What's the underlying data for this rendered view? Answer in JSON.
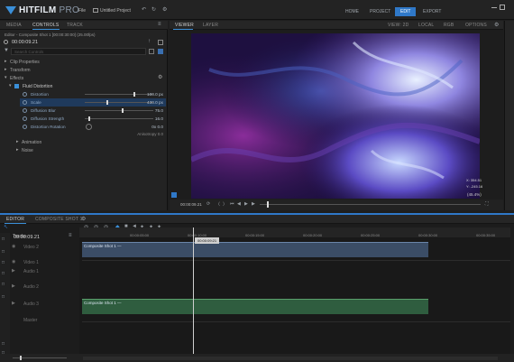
{
  "app": {
    "logo_name": "HITFILM",
    "logo_edition": "PRO",
    "menu_file": "File",
    "project_name": "Untitled Project",
    "undo_icon": "undo-icon",
    "redo_icon": "redo-icon",
    "settings_icon": "gear-icon"
  },
  "nav": {
    "tabs": [
      "HOME",
      "PROJECT",
      "EDIT",
      "EXPORT"
    ],
    "active": "EDIT"
  },
  "left_panel": {
    "tabs": [
      "MEDIA",
      "CONTROLS",
      "TRACK"
    ],
    "active_tab": "CONTROLS",
    "editor_title": "Editor - Composite Shot 1 [00:00:30:00] (25.00fps)",
    "timecode": "00:00:09.21",
    "search_placeholder": "Search Controls",
    "sections": [
      {
        "label": "Clip Properties"
      },
      {
        "label": "Transform"
      },
      {
        "label": "Effects"
      }
    ],
    "effect_name": "Fluid Distortion",
    "properties": [
      {
        "label": "Distortion",
        "value": "100.0 px",
        "fraction": 0.72
      },
      {
        "label": "Scale",
        "value": "430.0 px",
        "fraction": 0.32
      },
      {
        "label": "Diffusion Blur",
        "value": "75.0",
        "fraction": 0.55
      },
      {
        "label": "Diffusion Strength",
        "value": "16.0",
        "fraction": 0.06
      },
      {
        "label": "Distortion Rotation",
        "value": "0x     0.0",
        "fraction": null
      }
    ],
    "anisotropy_line": "Anisotropy  0.0",
    "after_sections": [
      {
        "label": "Animation"
      },
      {
        "label": "Noise"
      }
    ]
  },
  "viewer": {
    "tabs": [
      "VIEWER",
      "LAYER"
    ],
    "active_tab": "VIEWER",
    "view_label": "VIEW: 2D",
    "local_label": "LOCAL",
    "rgb_label": "RGB",
    "options_label": "OPTIONS",
    "timecode": "00:00:09.21",
    "readout_1": "X: 354.51",
    "readout_2": "Y: -245.16",
    "zoom_label": "(45.4%)"
  },
  "timeline": {
    "tabs": [
      "EDITOR",
      "COMPOSITE SHOT 1"
    ],
    "active_tab": "EDITOR",
    "timecode": "00:00:09.21",
    "playhead_tooltip": "00:00:09:21",
    "tracks_label": "Tracks",
    "ruler_ticks": [
      "00:00:05:00",
      "00:00:10:00",
      "00:00:15:00",
      "00:00:20:00",
      "00:00:25:00",
      "00:00:30:00",
      "00:00:35:00",
      "00:00:40:00"
    ],
    "track_rows": [
      {
        "label": "Video 2"
      },
      {
        "label": "Video 1"
      },
      {
        "label": "Audio 1"
      },
      {
        "label": "Audio 2"
      },
      {
        "label": "Audio 3"
      },
      {
        "label": "Master"
      }
    ],
    "clips": [
      {
        "label": "Composite Shot 1  —"
      },
      {
        "label": "Composite Shot 1  —"
      }
    ]
  }
}
